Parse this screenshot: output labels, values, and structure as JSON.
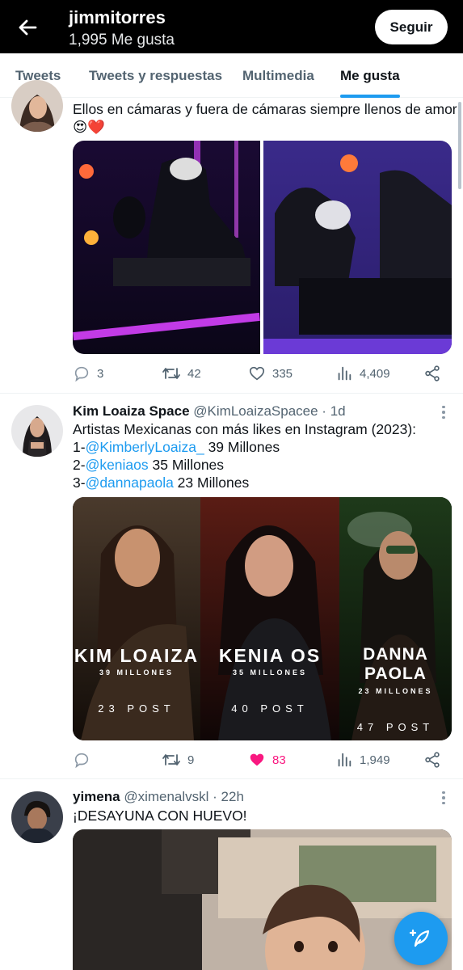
{
  "header": {
    "title": "jimmitorres",
    "subtitle": "1,995 Me gusta",
    "follow_label": "Seguir"
  },
  "tabs": [
    {
      "label": "Tweets"
    },
    {
      "label": "Tweets y respuestas"
    },
    {
      "label": "Multimedia"
    },
    {
      "label": "Me gusta",
      "active": true
    }
  ],
  "tweets": [
    {
      "text_line1": "Ellos en cámaras y fuera de cámaras siempre llenos de amor",
      "text_line2": "😍❤️",
      "actions": {
        "replies": "3",
        "retweets": "42",
        "likes": "335",
        "views": "4,409"
      }
    },
    {
      "name": "Kim Loaiza Space",
      "handle": "@KimLoaizaSpacee · 1d",
      "text_line1": "Artistas Mexicanas con más likes en Instagram (2023):",
      "list": [
        {
          "prefix": "1-",
          "mention": "@KimberlyLoaiza_",
          "suffix": " 39 Millones"
        },
        {
          "prefix": "2-",
          "mention": "@keniaos",
          "suffix": " 35 Millones"
        },
        {
          "prefix": "3-",
          "mention": "@dannapaola",
          "suffix": " 23 Millones"
        }
      ],
      "panels": [
        {
          "name": "KIM LOAIZA",
          "millones": "39 MILLONES",
          "post": "23 POST"
        },
        {
          "name": "KENIA OS",
          "millones": "35 MILLONES",
          "post": "40 POST"
        },
        {
          "name": "DANNA PAOLA",
          "millones": "23 MILLONES",
          "post": "47 POST"
        }
      ],
      "actions": {
        "replies": "",
        "retweets": "9",
        "likes": "83",
        "views": "1,949"
      }
    },
    {
      "name": "yimena",
      "handle": "@ximenalvskl · 22h",
      "text_line1": "¡DESAYUNA CON HUEVO!"
    }
  ],
  "colors": {
    "accent": "#1d9bf0",
    "like": "#f91880",
    "muted": "#536471"
  },
  "icons": [
    "back-arrow-icon",
    "reply-icon",
    "retweet-icon",
    "heart-icon",
    "views-icon",
    "share-icon",
    "more-icon",
    "compose-icon"
  ]
}
